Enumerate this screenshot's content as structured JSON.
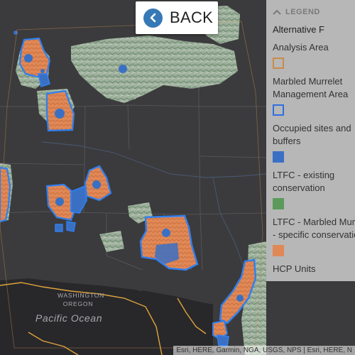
{
  "back_button": {
    "label": "BACK",
    "icon": "chevron-left-icon"
  },
  "legend": {
    "title": "LEGEND",
    "layer_title": "Alternative F",
    "items": [
      {
        "lines": [
          "Analysis Area"
        ],
        "swatch": "outline",
        "color": "#c98b4a"
      },
      {
        "lines": [
          "Marbled Murrelet",
          "Management Area"
        ],
        "swatch": "outline",
        "color": "#2f6fe0"
      },
      {
        "lines": [
          "Occupied sites and",
          "buffers"
        ],
        "swatch": "fill",
        "color": "#3a70c4"
      },
      {
        "lines": [
          "LTFC - existing",
          "conservation"
        ],
        "swatch": "fill",
        "color": "#5b9a5b"
      },
      {
        "lines": [
          "LTFC - Marbled Murrelet",
          "- specific conservation"
        ],
        "swatch": "fill",
        "color": "#e08856"
      },
      {
        "lines": [
          "HCP Units"
        ],
        "swatch": "none",
        "color": ""
      }
    ]
  },
  "map_labels": {
    "state_north": "WASHINGTON",
    "state_south": "OREGON",
    "ocean": "Pacific Ocean"
  },
  "attribution": "Esri, HERE, Garmin, NGA, USGS, NPS | Esri, HERE, N",
  "colors": {
    "basemap": "#3b3b3d",
    "water": "#27272a",
    "forest": "#8ea58e",
    "orange": "#e08856",
    "blue_fill": "#3a70c4",
    "blue_outline": "#2f7ff0",
    "road": "#e0a43a"
  }
}
